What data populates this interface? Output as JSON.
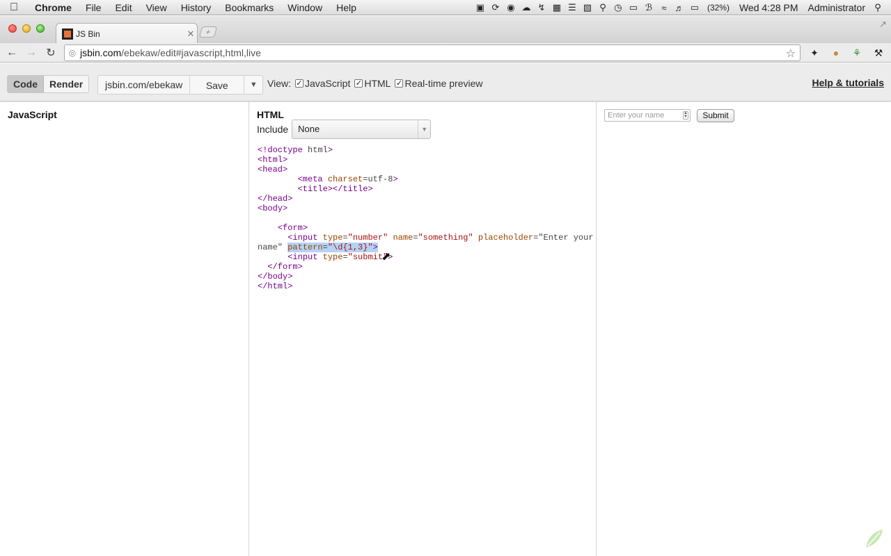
{
  "menubar": {
    "app": "Chrome",
    "items": [
      "File",
      "Edit",
      "View",
      "History",
      "Bookmarks",
      "Window",
      "Help"
    ],
    "battery": "(32%)",
    "clock": "Wed 4:28 PM",
    "user": "Administrator"
  },
  "browser": {
    "tab_title": "JS Bin",
    "url_host": "jsbin.com",
    "url_path": "/ebekaw/edit#javascript,html,live"
  },
  "jsbin": {
    "code_label": "Code",
    "render_label": "Render",
    "bin_url": "jsbin.com/ebekaw",
    "save_label": "Save",
    "view_label": "View:",
    "view_javascript": "JavaScript",
    "view_html": "HTML",
    "view_realtime": "Real-time preview",
    "help_label": "Help & tutorials"
  },
  "panels": {
    "javascript_title": "JavaScript",
    "html_title": "HTML",
    "include_label": "Include",
    "include_value": "None"
  },
  "code_lines": [
    "<!doctype html>",
    "<html>",
    "<head>",
    "        <meta charset=utf-8>",
    "        <title></title>",
    "</head>",
    "<body>",
    "",
    "    <form>",
    "      <input type=\"number\" name=\"something\" placeholder=\"Enter your",
    "name\" pattern=\"\\d{1,3}\">",
    "      <input type=\"submit\">",
    "  </form>",
    "</body>",
    "</html>"
  ],
  "live": {
    "input_placeholder": "Enter your name",
    "submit_label": "Submit"
  }
}
